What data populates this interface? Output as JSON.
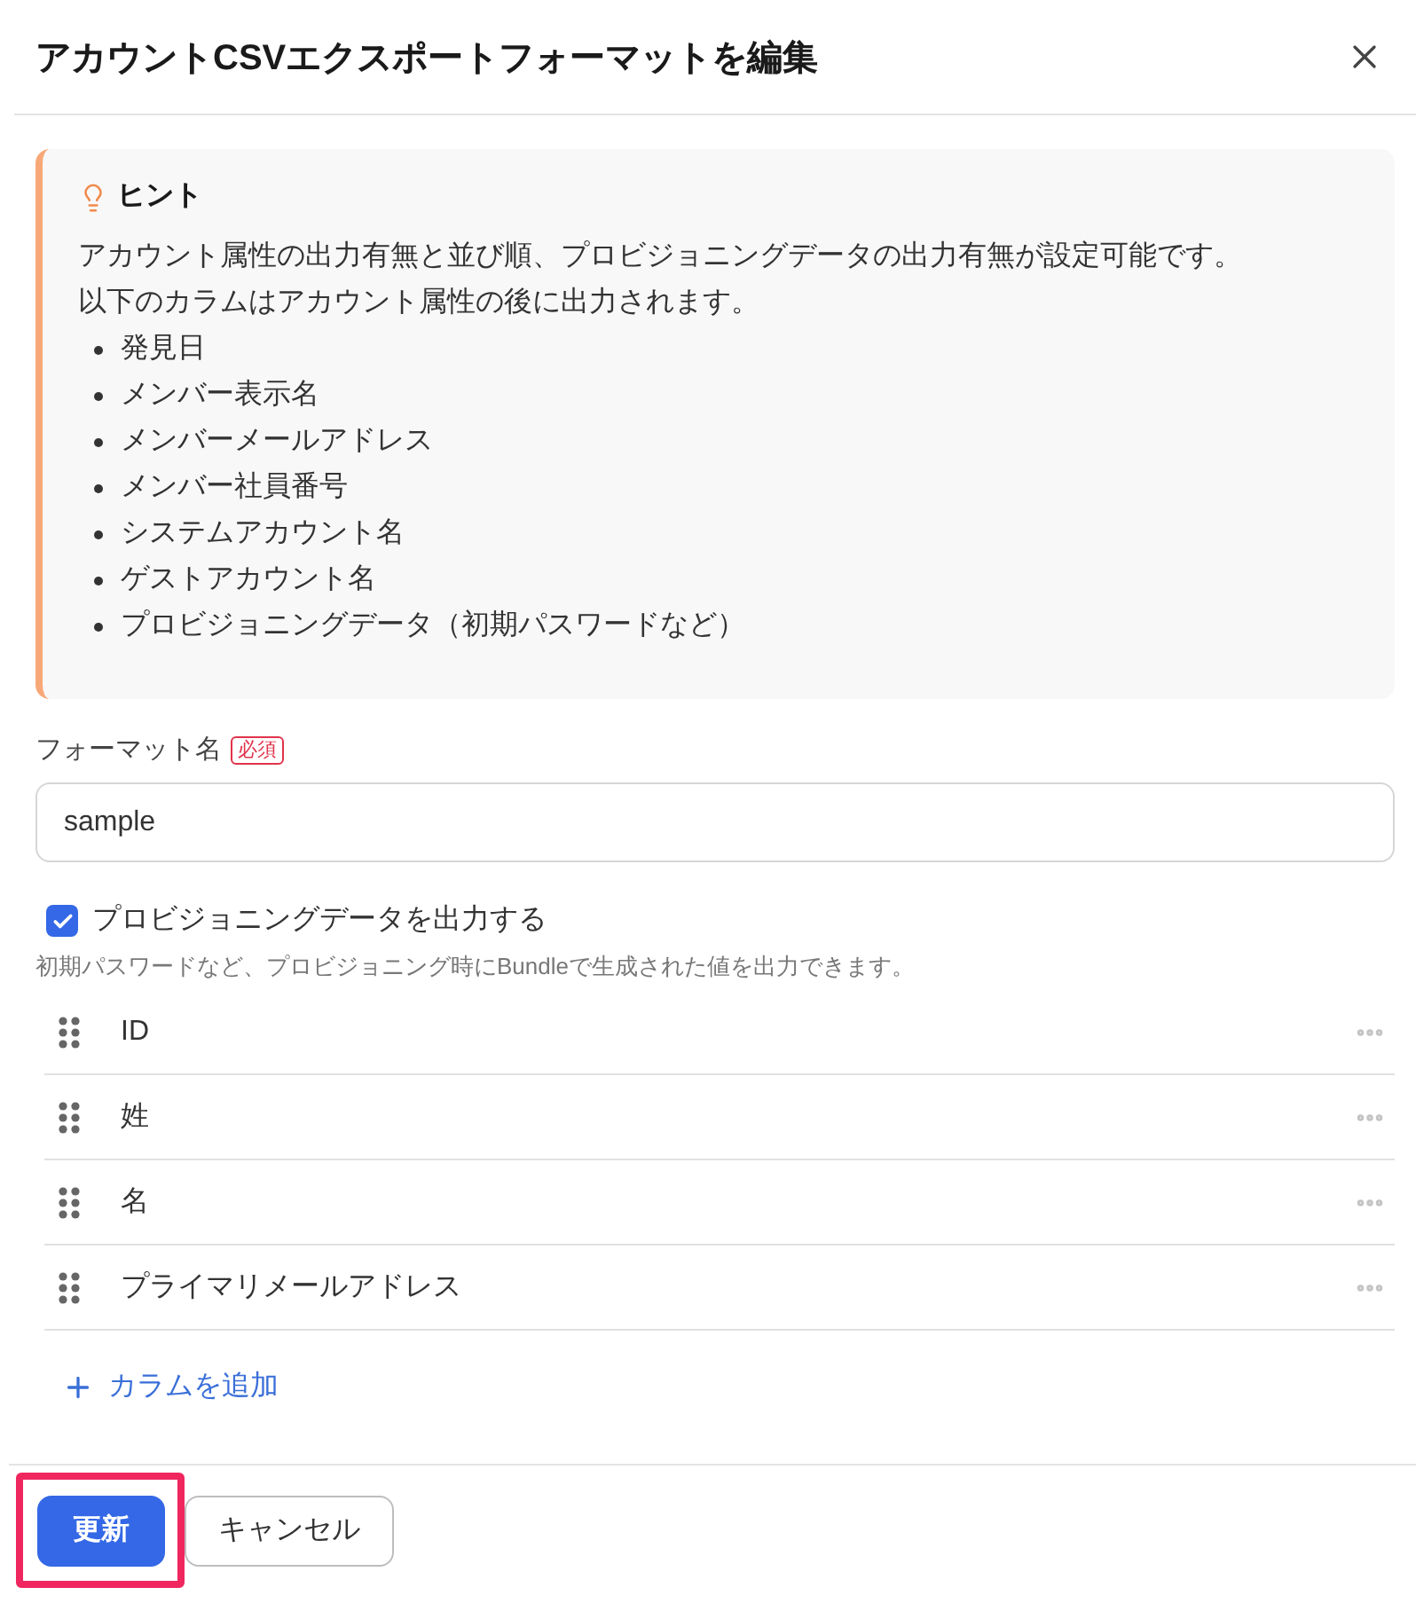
{
  "dialog": {
    "title": "アカウントCSVエクスポートフォーマットを編集"
  },
  "hint": {
    "heading": "ヒント",
    "lines": [
      "アカウント属性の出力有無と並び順、プロビジョニングデータの出力有無が設定可能です。",
      "以下のカラムはアカウント属性の後に出力されます。"
    ],
    "items": [
      "発見日",
      "メンバー表示名",
      "メンバーメールアドレス",
      "メンバー社員番号",
      "システムアカウント名",
      "ゲストアカウント名",
      "プロビジョニングデータ（初期パスワードなど）"
    ]
  },
  "format_name": {
    "label": "フォーマット名",
    "badge": "必須",
    "value": "sample"
  },
  "provisioning": {
    "label": "プロビジョニングデータを出力する",
    "checked": true,
    "help": "初期パスワードなど、プロビジョニング時にBundleで生成された値を出力できます。"
  },
  "columns": [
    {
      "name": "ID"
    },
    {
      "name": "姓"
    },
    {
      "name": "名"
    },
    {
      "name": "プライマリメールアドレス"
    }
  ],
  "add_column": {
    "label": "カラムを追加"
  },
  "buttons": [
    {
      "label": "更新",
      "kind": "primary",
      "highlighted": true
    },
    {
      "label": "キャンセル",
      "kind": "secondary",
      "highlighted": false
    }
  ]
}
